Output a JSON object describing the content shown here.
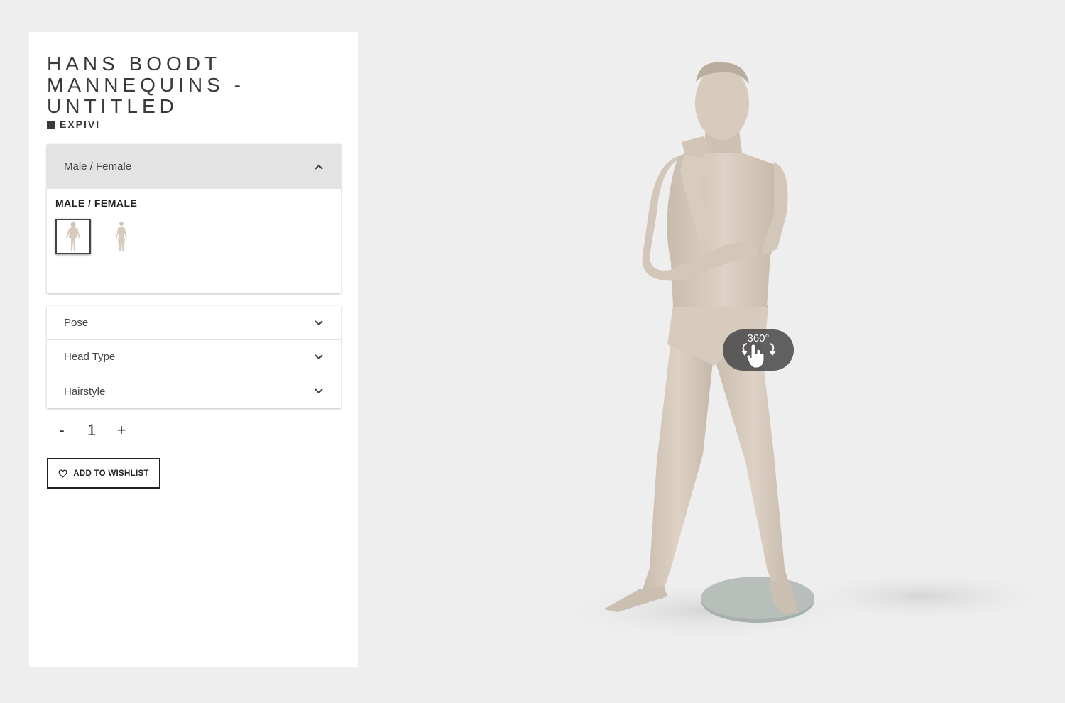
{
  "product": {
    "title": "HANS BOODT MANNEQUINS - UNTITLED",
    "brand": "EXPIVI"
  },
  "configurator": {
    "open_section": {
      "header": "Male / Female",
      "label": "MALE / FEMALE",
      "options": [
        {
          "icon": "male-mannequin-thumbnail",
          "selected": true
        },
        {
          "icon": "female-mannequin-thumbnail",
          "selected": false
        }
      ]
    },
    "sections": [
      {
        "label": "Pose"
      },
      {
        "label": "Head Type"
      },
      {
        "label": "Hairstyle"
      }
    ]
  },
  "quantity": {
    "decrement": "-",
    "value": "1",
    "increment": "+"
  },
  "wishlist": {
    "label": "ADD TO WISHLIST",
    "icon": "heart-icon"
  },
  "viewer": {
    "rotate_label": "360°",
    "rotate_icon": "hand-rotate-icon"
  }
}
